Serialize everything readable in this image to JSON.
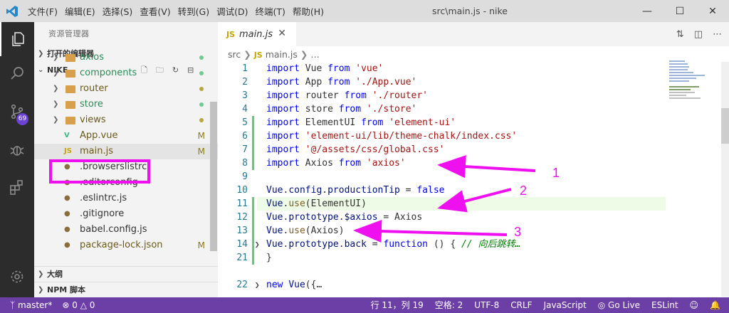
{
  "titlebar": {
    "menu": [
      "文件(F)",
      "编辑(E)",
      "选择(S)",
      "查看(V)",
      "转到(G)",
      "调试(D)",
      "终端(T)",
      "帮助(H)"
    ],
    "title": "src\\main.js - nike"
  },
  "activity": {
    "scm_badge": "69"
  },
  "sidebar": {
    "title": "资源管理器",
    "open_editors": "打开的编辑器",
    "project": "NIKE",
    "bottom_sections": [
      "大纲",
      "NPM 脚本"
    ],
    "tree": [
      {
        "label": "axios",
        "kind": "folder",
        "color": "#2e8b57",
        "marker": "dot",
        "marker_color": "#73c991"
      },
      {
        "label": "components",
        "kind": "folder",
        "color": "#2e8b57",
        "marker": "dot",
        "marker_color": "#73c991"
      },
      {
        "label": "router",
        "kind": "folder",
        "color": "#6b5a1a",
        "marker": "dot",
        "marker_color": "#b5a642"
      },
      {
        "label": "store",
        "kind": "folder",
        "color": "#2e8b57",
        "marker": "dot",
        "marker_color": "#73c991"
      },
      {
        "label": "views",
        "kind": "folder",
        "color": "#6b5a1a",
        "marker": "dot",
        "marker_color": "#b5a642"
      },
      {
        "label": "App.vue",
        "kind": "vue",
        "color": "#6b5a1a",
        "marker": "M"
      },
      {
        "label": "main.js",
        "kind": "js",
        "color": "#6b5a1a",
        "marker": "M",
        "selected": true
      },
      {
        "label": ".browserslistrc",
        "kind": "file",
        "color": "#333333"
      },
      {
        "label": ".editorconfig",
        "kind": "file",
        "color": "#333333"
      },
      {
        "label": ".eslintrc.js",
        "kind": "file",
        "color": "#333333"
      },
      {
        "label": ".gitignore",
        "kind": "file",
        "color": "#333333"
      },
      {
        "label": "babel.config.js",
        "kind": "file",
        "color": "#333333"
      },
      {
        "label": "package-lock.json",
        "kind": "file",
        "color": "#6b5a1a",
        "marker": "M"
      }
    ]
  },
  "editor": {
    "tab": {
      "icon": "JS",
      "name": "main.js"
    },
    "breadcrumb": {
      "folder": "src",
      "icon": "JS",
      "file": "main.js",
      "rest": "…"
    },
    "lines": [
      {
        "n": "1",
        "parts": [
          [
            "kw",
            "import"
          ],
          [
            "plain",
            " Vue "
          ],
          [
            "kw",
            "from"
          ],
          [
            "plain",
            " "
          ],
          [
            "str",
            "'vue'"
          ]
        ]
      },
      {
        "n": "2",
        "parts": [
          [
            "kw",
            "import"
          ],
          [
            "plain",
            " App "
          ],
          [
            "kw",
            "from"
          ],
          [
            "plain",
            " "
          ],
          [
            "str",
            "'./App.vue'"
          ]
        ]
      },
      {
        "n": "3",
        "parts": [
          [
            "kw",
            "import"
          ],
          [
            "plain",
            " router "
          ],
          [
            "kw",
            "from"
          ],
          [
            "plain",
            " "
          ],
          [
            "str",
            "'./router'"
          ]
        ]
      },
      {
        "n": "4",
        "parts": [
          [
            "kw",
            "import"
          ],
          [
            "plain",
            " store "
          ],
          [
            "kw",
            "from"
          ],
          [
            "plain",
            " "
          ],
          [
            "str",
            "'./store'"
          ]
        ]
      },
      {
        "n": "5",
        "parts": [
          [
            "kw",
            "import"
          ],
          [
            "plain",
            " ElementUI "
          ],
          [
            "kw",
            "from"
          ],
          [
            "plain",
            " "
          ],
          [
            "str",
            "'element-ui'"
          ]
        ]
      },
      {
        "n": "6",
        "parts": [
          [
            "kw",
            "import"
          ],
          [
            "plain",
            " "
          ],
          [
            "str",
            "'element-ui/lib/theme-chalk/index.css'"
          ]
        ]
      },
      {
        "n": "7",
        "parts": [
          [
            "kw",
            "import"
          ],
          [
            "plain",
            " "
          ],
          [
            "str",
            "'@/assets/css/global.css'"
          ]
        ]
      },
      {
        "n": "8",
        "parts": [
          [
            "kw",
            "import"
          ],
          [
            "plain",
            " Axios "
          ],
          [
            "kw",
            "from"
          ],
          [
            "plain",
            " "
          ],
          [
            "str",
            "'axios'"
          ]
        ]
      },
      {
        "n": "9",
        "parts": []
      },
      {
        "n": "10",
        "parts": [
          [
            "vr",
            "Vue"
          ],
          [
            "plain",
            "."
          ],
          [
            "vr",
            "config"
          ],
          [
            "plain",
            "."
          ],
          [
            "vr",
            "productionTip"
          ],
          [
            "plain",
            " = "
          ],
          [
            "kw",
            "false"
          ]
        ]
      },
      {
        "n": "11",
        "parts": [
          [
            "vr",
            "Vue"
          ],
          [
            "plain",
            "."
          ],
          [
            "fn",
            "use"
          ],
          [
            "plain",
            "(ElementUI)"
          ]
        ]
      },
      {
        "n": "12",
        "parts": [
          [
            "vr",
            "Vue"
          ],
          [
            "plain",
            "."
          ],
          [
            "vr",
            "prototype"
          ],
          [
            "plain",
            "."
          ],
          [
            "vr",
            "$axios"
          ],
          [
            "plain",
            " = Axios"
          ]
        ]
      },
      {
        "n": "13",
        "parts": [
          [
            "vr",
            "Vue"
          ],
          [
            "plain",
            "."
          ],
          [
            "fn",
            "use"
          ],
          [
            "plain",
            "(Axios)"
          ]
        ]
      },
      {
        "n": "14",
        "parts": [
          [
            "vr",
            "Vue"
          ],
          [
            "plain",
            "."
          ],
          [
            "vr",
            "prototype"
          ],
          [
            "plain",
            "."
          ],
          [
            "vr",
            "back"
          ],
          [
            "plain",
            " = "
          ],
          [
            "kw",
            "function"
          ],
          [
            "plain",
            " () { "
          ],
          [
            "cm",
            "// 向后跳转…"
          ]
        ]
      },
      {
        "n": "21",
        "parts": [
          [
            "plain",
            "}"
          ]
        ]
      },
      {
        "n": "22",
        "parts": [
          [
            "kw",
            "new"
          ],
          [
            "plain",
            " "
          ],
          [
            "vr",
            "Vue"
          ],
          [
            "plain",
            "({…"
          ]
        ]
      }
    ]
  },
  "annotations": [
    "1",
    "2",
    "3"
  ],
  "status": {
    "branch": "master*",
    "errors": "0",
    "warnings": "0",
    "position": "行 11，列 19",
    "indent": "空格: 2",
    "encoding": "UTF-8",
    "eol": "CRLF",
    "language": "JavaScript",
    "golive": "Go Live",
    "eslint": "ESLint"
  }
}
